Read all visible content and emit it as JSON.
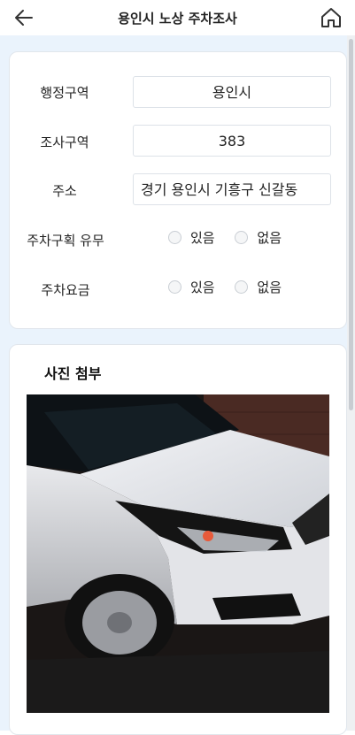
{
  "header": {
    "title": "용인시 노상 주차조사",
    "back_icon": "arrow-left-icon",
    "home_icon": "home-icon"
  },
  "form": {
    "district": {
      "label": "행정구역",
      "value": "용인시"
    },
    "survey_area": {
      "label": "조사구역",
      "value": "383"
    },
    "address": {
      "label": "주소",
      "value": "경기 용인시 기흥구 신갈동"
    },
    "parking_zone": {
      "label": "주차구획 유무",
      "options": [
        "있음",
        "없음"
      ]
    },
    "parking_fee": {
      "label": "주차요금",
      "options": [
        "있음",
        "없음"
      ]
    }
  },
  "photo_section": {
    "title": "사진 첨부",
    "image": "white-car-photo"
  },
  "colors": {
    "background": "#eaf3fc",
    "card": "#ffffff",
    "border": "#dde2e8"
  }
}
